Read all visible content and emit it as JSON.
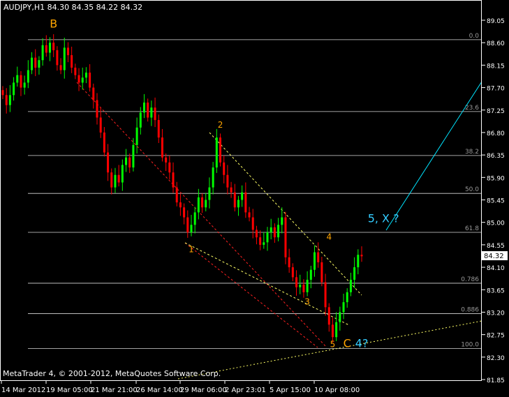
{
  "window": {
    "symbol_header": "AUDJPY,H1  84.30 84.35 84.22 84.32",
    "copyright": "MetaTrader 4, © 2001-2012, MetaQuotes Software Corp.",
    "current_price_label": "84.32"
  },
  "colors": {
    "background": "#000000",
    "axis": "#ffffff",
    "bull_candle": "#00ff00",
    "bear_candle": "#ff0000",
    "fib_line": "#d8d8d8",
    "fib_text": "#9a9a9a",
    "wave_label": "#ffa500",
    "cyan_label": "#33ccff",
    "red_channel": "#ff2020",
    "yellow_channel": "#ffff66",
    "cyan_line": "#00e5ff"
  },
  "chart_data": {
    "type": "candlestick",
    "title": "AUDJPY,H1",
    "ohlc_header": {
      "open": 84.3,
      "high": 84.35,
      "low": 84.22,
      "close": 84.32
    },
    "y_ticks": [
      "89.05",
      "88.60",
      "88.15",
      "87.70",
      "87.25",
      "86.80",
      "86.35",
      "85.90",
      "85.45",
      "85.00",
      "84.55",
      "84.10",
      "83.65",
      "83.20",
      "82.75",
      "82.30",
      "81.85"
    ],
    "x_ticks": [
      "14 Mar 2012",
      "19 Mar 05:00",
      "21 Mar 21:00",
      "26 Mar 14:00",
      "29 Mar 06:00",
      "2 Apr 23:01",
      "5 Apr 15:00",
      "10 Apr 08:00"
    ],
    "ylim": [
      81.85,
      89.05
    ],
    "fib_levels": [
      {
        "label": "0.0",
        "price": 88.66
      },
      {
        "label": "23.6",
        "price": 87.22
      },
      {
        "label": "38.2",
        "price": 86.34
      },
      {
        "label": "50.0",
        "price": 85.58
      },
      {
        "label": "61.8",
        "price": 84.8
      },
      {
        "label": "0.786",
        "price": 83.78
      },
      {
        "label": "0.886",
        "price": 83.17
      },
      {
        "label": "100.0",
        "price": 82.47
      }
    ],
    "wave_labels": [
      {
        "text": "B",
        "price": 88.9,
        "time_index": 14,
        "color": "wave"
      },
      {
        "text": "1",
        "price": 84.4,
        "time_index": 52,
        "color": "wave"
      },
      {
        "text": "2",
        "price": 86.9,
        "time_index": 60,
        "color": "wave"
      },
      {
        "text": "3",
        "price": 83.35,
        "time_index": 84,
        "color": "wave"
      },
      {
        "text": "4",
        "price": 84.65,
        "time_index": 90,
        "color": "wave"
      },
      {
        "text": "5",
        "price": 82.5,
        "time_index": 91,
        "color": "wave"
      },
      {
        "text": "C",
        "price": 82.5,
        "time_index": 95,
        "color": "wave"
      },
      {
        "text": "4?",
        "price": 82.5,
        "time_index": 99,
        "color": "cyan"
      },
      {
        "text": "5, X ?",
        "price": 85.0,
        "time_index": 105,
        "color": "cyan"
      }
    ],
    "closes": [
      87.55,
      87.35,
      87.55,
      87.8,
      87.95,
      87.7,
      87.8,
      88.05,
      88.3,
      88.1,
      88.25,
      88.55,
      88.4,
      88.6,
      88.45,
      88.15,
      88.05,
      88.5,
      88.35,
      88.1,
      87.95,
      87.8,
      87.9,
      88.0,
      87.7,
      87.45,
      87.1,
      86.8,
      86.4,
      86.0,
      85.7,
      85.95,
      85.8,
      86.15,
      86.3,
      86.1,
      86.55,
      86.9,
      87.2,
      87.4,
      87.1,
      87.3,
      87.05,
      86.7,
      86.3,
      86.2,
      86.0,
      85.7,
      85.4,
      85.3,
      85.1,
      84.8,
      84.95,
      85.2,
      85.5,
      85.3,
      85.45,
      85.7,
      86.1,
      86.7,
      86.2,
      85.95,
      85.7,
      85.6,
      85.3,
      85.45,
      85.6,
      85.2,
      85.1,
      84.85,
      84.7,
      84.55,
      84.6,
      84.8,
      84.9,
      84.7,
      84.95,
      85.1,
      84.3,
      84.1,
      83.9,
      83.7,
      83.75,
      83.6,
      83.85,
      84.05,
      84.4,
      84.2,
      83.8,
      83.3,
      82.95,
      82.7,
      83.0,
      83.2,
      83.4,
      83.6,
      83.85,
      84.1,
      84.35,
      84.32
    ]
  }
}
